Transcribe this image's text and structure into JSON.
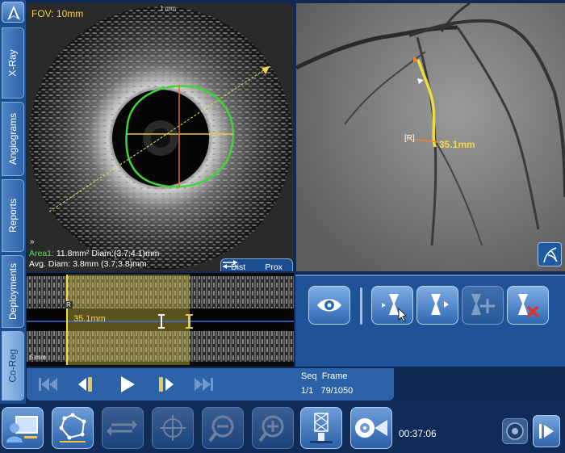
{
  "tabs": [
    {
      "label": "X-Ray"
    },
    {
      "label": "Angiograms"
    },
    {
      "label": "Reports"
    },
    {
      "label": "Deployments"
    },
    {
      "label": "Co-Reg"
    }
  ],
  "ivus": {
    "fov": "FOV: 10mm",
    "scale": "1 mm",
    "area_line_prefix": "Area1:",
    "area_line": " 11.8mm² Diam:(3.7;4.1)mm",
    "avg_line": "Avg. Diam: 3.8mm   (3.7;3.8)mm",
    "chevron": "»",
    "dist_label": "Dist",
    "prox_label": "Prox"
  },
  "angio": {
    "length_label": "35.1mm",
    "r_label": "[R]"
  },
  "lmode": {
    "length_label": "35.1mm",
    "r_marker": "R",
    "scale": "5 mm"
  },
  "player": {
    "seq_header": "Seq",
    "frame_header": "Frame",
    "seq_value": "1/1",
    "frame_value": "79/1050",
    "progress_fraction": 0.075
  },
  "status": {
    "elapsed_time": "00:37:06"
  },
  "colors": {
    "accent": "#f5d64a",
    "contour": "#3ed43a",
    "panel": "#1f5296"
  },
  "icons": {
    "view": "eye-icon",
    "set_marker": "marker-cursor-icon",
    "next_marker": "marker-next-icon",
    "add_marker": "marker-add-icon",
    "delete_marker": "marker-delete-icon"
  }
}
